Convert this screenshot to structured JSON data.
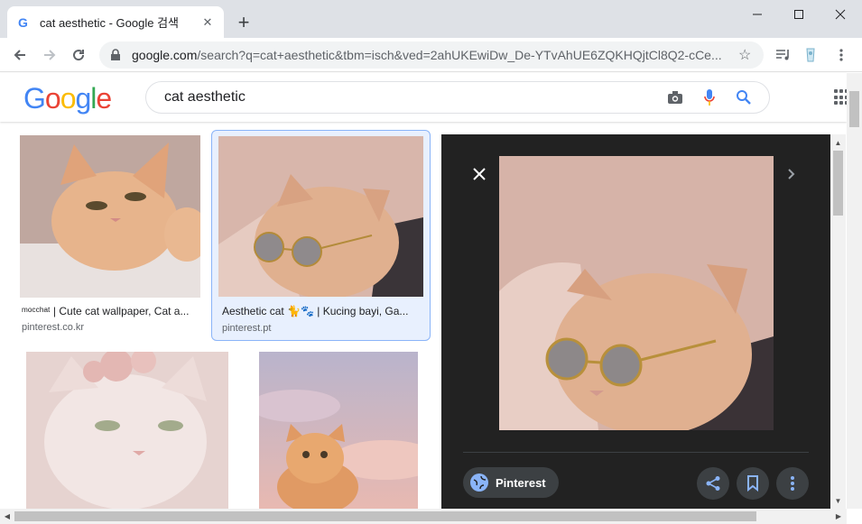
{
  "browser": {
    "tab_title": "cat aesthetic - Google 검색",
    "favicon": "G",
    "url_domain": "google.com",
    "url_path": "/search?q=cat+aesthetic&tbm=isch&ved=2ahUKEwiDw_De-YTvAhUE6ZQKHQjtCl8Q2-cCe..."
  },
  "header": {
    "logo": [
      "G",
      "o",
      "o",
      "g",
      "l",
      "e"
    ],
    "logo_colors": [
      "#4285f4",
      "#ea4335",
      "#fbbc05",
      "#4285f4",
      "#34a853",
      "#ea4335"
    ],
    "search_value": "cat aesthetic"
  },
  "results": [
    {
      "caption": "ᵐᵒᶜᶜʰᵃᵗ | Cute cat wallpaper, Cat a...",
      "source": "pinterest.co.kr"
    },
    {
      "caption": "Aesthetic cat 🐈🐾 | Kucing bayi, Ga...",
      "source": "pinterest.pt"
    }
  ],
  "preview": {
    "close_icon": "close-icon",
    "source_label": "Pinterest"
  },
  "colors": {
    "accent": "#8ab4f8",
    "preview_bg": "#222222",
    "selected_bg": "#e8f0fe"
  }
}
